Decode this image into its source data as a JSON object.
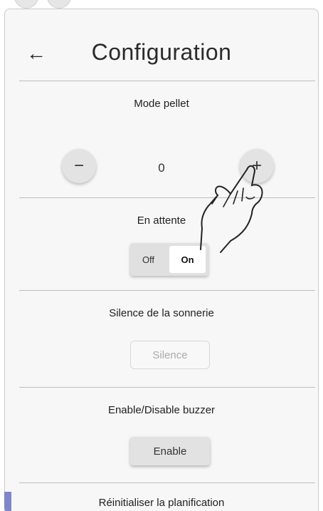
{
  "header": {
    "title": "Configuration",
    "back_icon": "arrow-left-icon"
  },
  "pellet_mode": {
    "label": "Mode pellet",
    "value": "0",
    "minus_label": "−",
    "plus_label": "+"
  },
  "standby": {
    "label": "En attente",
    "off_label": "Off",
    "on_label": "On",
    "selected": "On"
  },
  "ringer_silence": {
    "label": "Silence de la sonnerie",
    "button_label": "Silence"
  },
  "buzzer": {
    "label": "Enable/Disable buzzer",
    "button_label": "Enable"
  },
  "reset_schedule": {
    "label": "Réinitialiser la planification"
  },
  "colors": {
    "panel_bg": "#f7f7f7",
    "accent": "#7f86c9",
    "divider": "#bdbdbd"
  }
}
